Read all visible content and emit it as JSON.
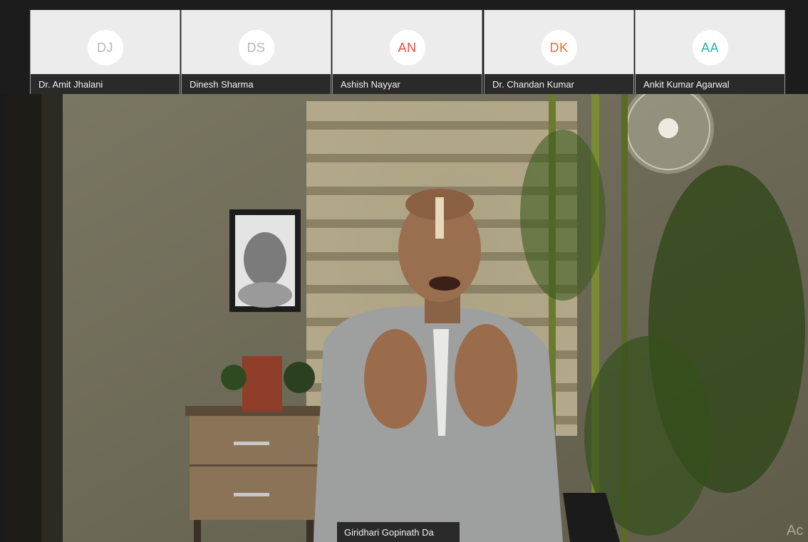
{
  "participants": [
    {
      "initials": "DJ",
      "name": "Dr. Amit Jhalani",
      "color": "#b7b7b7"
    },
    {
      "initials": "DS",
      "name": "Dinesh Sharma",
      "color": "#b7b7b7"
    },
    {
      "initials": "AN",
      "name": "Ashish Nayyar",
      "color": "#ef4a3c"
    },
    {
      "initials": "DK",
      "name": "Dr. Chandan Kumar",
      "color": "#f06a2e"
    },
    {
      "initials": "AA",
      "name": "Ankit Kumar Agarwal",
      "color": "#28b3a6"
    }
  ],
  "active_speaker": {
    "name": "Giridhari Gopinath Da"
  },
  "watermark": "Ac"
}
